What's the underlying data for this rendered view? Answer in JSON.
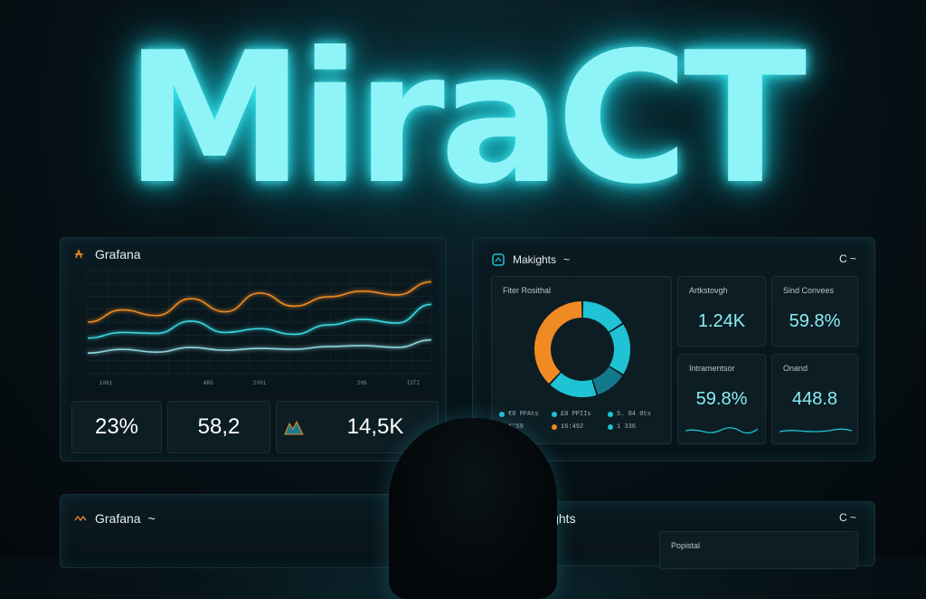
{
  "hero": {
    "title": "MiraCT"
  },
  "grafana_top": {
    "title": "Grafana",
    "kpis": [
      "23%",
      "58,2",
      "14,5K"
    ]
  },
  "insights_top": {
    "title": "Makights",
    "title_suffix": "~",
    "header_right": "C",
    "header_right_suffix": "~",
    "donut_card_title": "Fiter Rosithal",
    "legend": [
      {
        "label": "€8 PPAts",
        "color": "#1fc3d3"
      },
      {
        "label": "£0 PPIIs",
        "color": "#1fc3d3"
      },
      {
        "label": "5. 84 0ts",
        "color": "#1fc3d3"
      },
      {
        "label": "1°59",
        "color": "#f08a22"
      },
      {
        "label": "16:492",
        "color": "#f08a22"
      },
      {
        "label": "1 336",
        "color": "#1fc3d3"
      }
    ],
    "kpis": [
      {
        "title": "Artkstovgh",
        "value": "1.24K"
      },
      {
        "title": "Sind Convees",
        "value": "59.8%"
      },
      {
        "title": "Intramentsor",
        "value": "59.8%"
      },
      {
        "title": "Onand",
        "value": "448.8"
      }
    ]
  },
  "grafana_bottom": {
    "title": "Grafana",
    "title_suffix": "~"
  },
  "insights_bottom": {
    "title": "ights",
    "header_right": "C",
    "header_right_suffix": "~",
    "card_title": "Popistal"
  },
  "chart_data": {
    "type": "line",
    "title": "",
    "x": [
      "1061",
      "",
      "ARG",
      "2Y01",
      "",
      "2H6",
      "ISTI"
    ],
    "series": [
      {
        "color": "#f08a22",
        "values": [
          5.5,
          6.8,
          6.2,
          8.0,
          6.6,
          8.6,
          7.2,
          8.2,
          8.8,
          8.4,
          9.8
        ]
      },
      {
        "color": "#3ad7de",
        "values": [
          3.8,
          4.4,
          4.3,
          5.6,
          4.4,
          4.8,
          4.2,
          5.2,
          5.8,
          5.4,
          7.4
        ]
      },
      {
        "color": "#8fd5de",
        "values": [
          2.2,
          2.6,
          2.3,
          2.8,
          2.5,
          2.7,
          2.6,
          2.9,
          3.0,
          2.8,
          3.6
        ]
      }
    ],
    "ylim": [
      0,
      11
    ],
    "grid": true
  },
  "colors": {
    "accent": "#6ee9ef",
    "orange": "#f08a22",
    "teal": "#1fc3d3",
    "dark_teal": "#127a8a"
  }
}
